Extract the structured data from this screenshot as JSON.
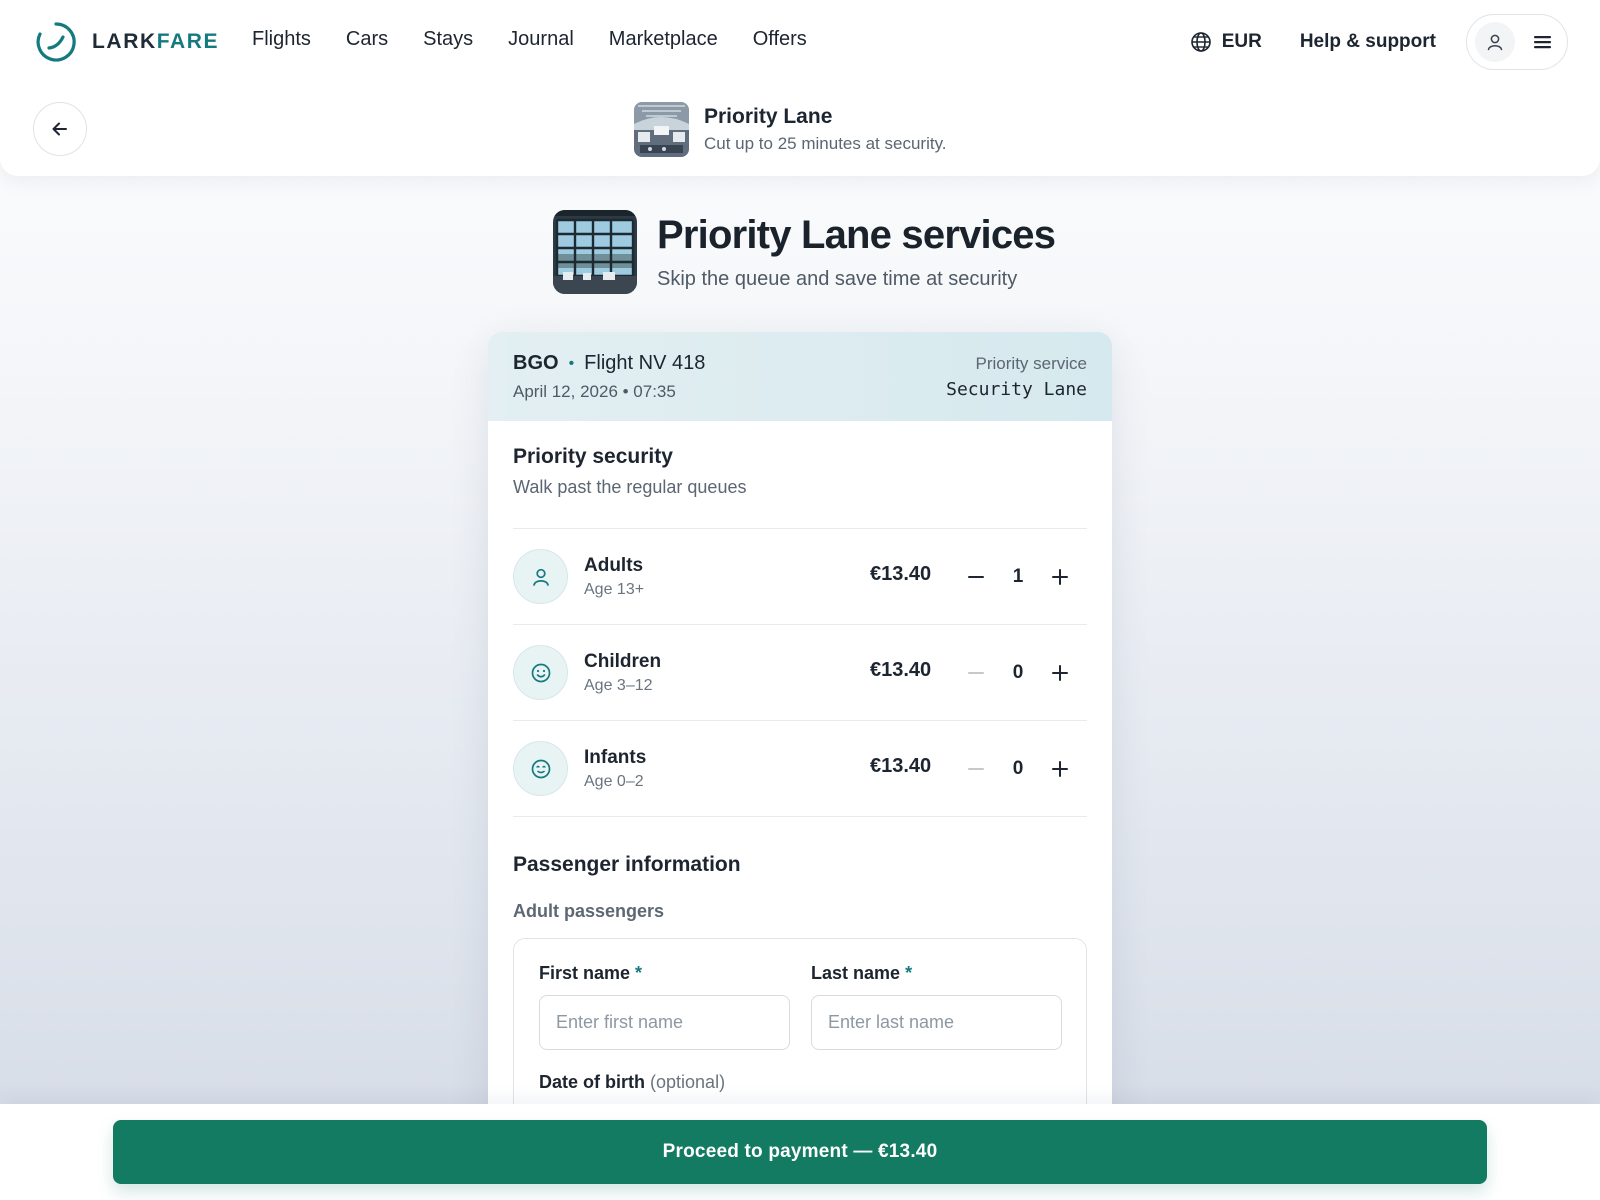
{
  "brand": {
    "name_part1": "LARK",
    "name_part2": "FARE",
    "accent": "#157a80"
  },
  "nav": {
    "links": [
      "Flights",
      "Cars",
      "Stays",
      "Journal",
      "Marketplace",
      "Offers"
    ],
    "currency": "EUR",
    "help": "Help & support"
  },
  "context": {
    "title": "Priority Lane",
    "subtitle": "Cut up to 25 minutes at security."
  },
  "hero": {
    "title": "Priority Lane services",
    "subtitle": "Skip the queue and save time at security"
  },
  "flight": {
    "airport": "BGO",
    "separator": "•",
    "flight": "Flight NV 418",
    "date": "April 12, 2026 • 07:35",
    "service_label": "Priority service",
    "service_value": "Security Lane"
  },
  "priority": {
    "title": "Priority security",
    "subtitle": "Walk past the regular queues",
    "rows": [
      {
        "name": "Adults",
        "age": "Age 13+",
        "price": "€13.40",
        "count": "1",
        "icon": "person-icon"
      },
      {
        "name": "Children",
        "age": "Age 3–12",
        "price": "€13.40",
        "count": "0",
        "icon": "smiley-icon"
      },
      {
        "name": "Infants",
        "age": "Age 0–2",
        "price": "€13.40",
        "count": "0",
        "icon": "baby-face-icon"
      }
    ]
  },
  "passenger": {
    "title": "Passenger information",
    "group": "Adult passengers",
    "first_name_label": "First name",
    "first_name_placeholder": "Enter first name",
    "last_name_label": "Last name",
    "last_name_placeholder": "Enter last name",
    "required_mark": "*",
    "dob_label": "Date of birth",
    "dob_optional": "(optional)"
  },
  "footer": {
    "pay_label": "Proceed to payment — €13.40",
    "pay_color": "#127b62"
  }
}
